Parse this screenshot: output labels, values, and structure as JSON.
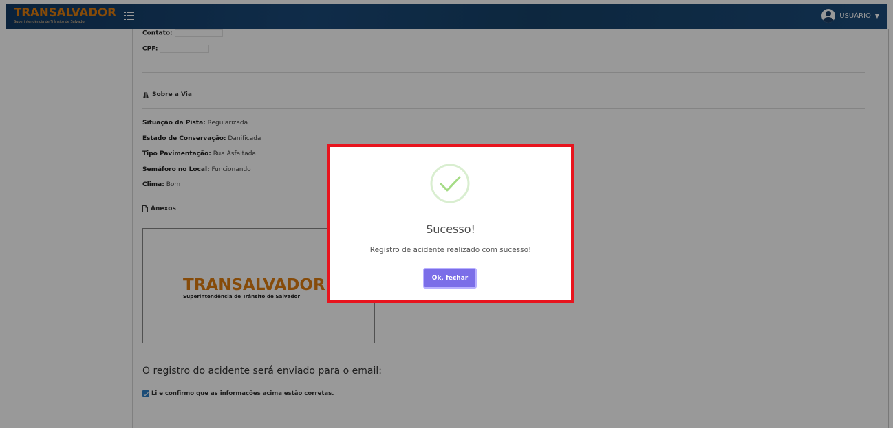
{
  "header": {
    "logo_main": "TRANSALVADOR",
    "logo_sub": "Superintendência de Trânsito de Salvador",
    "user_label": "USUÁRIO"
  },
  "contact": {
    "contato_label": "Contato:",
    "cpf_label": "CPF:"
  },
  "via": {
    "section_title": "Sobre a Via",
    "situacao_label": "Situação da Pista:",
    "situacao_value": "Regularizada",
    "estado_label": "Estado de Conservação:",
    "estado_value": "Danificada",
    "pavimentacao_label": "Tipo Pavimentação:",
    "pavimentacao_value": "Rua Asfaltada",
    "semaforo_label": "Semáforo no Local:",
    "semaforo_value": "Funcionando",
    "clima_label": "Clima:",
    "clima_value": "Bom"
  },
  "anexos": {
    "section_title": "Anexos",
    "image_logo_main": "TRANSALVADOR",
    "image_logo_sub": "Superintendência de Trânsito de Salvador"
  },
  "email": {
    "title": "O registro do acidente será enviado para o email:",
    "confirm_text": "Li e confirmo que as informações acima estão corretas."
  },
  "dialog": {
    "title": "Sucesso!",
    "message": "Registro de acidente realizado com sucesso!",
    "button_label": "Ok, fechar"
  },
  "colors": {
    "navbar": "#1a4a7a",
    "logo_orange": "#e07d10",
    "button_purple": "#7b6ee8",
    "highlight_red": "#e8141e",
    "checkbox_blue": "#2d7fc6"
  }
}
